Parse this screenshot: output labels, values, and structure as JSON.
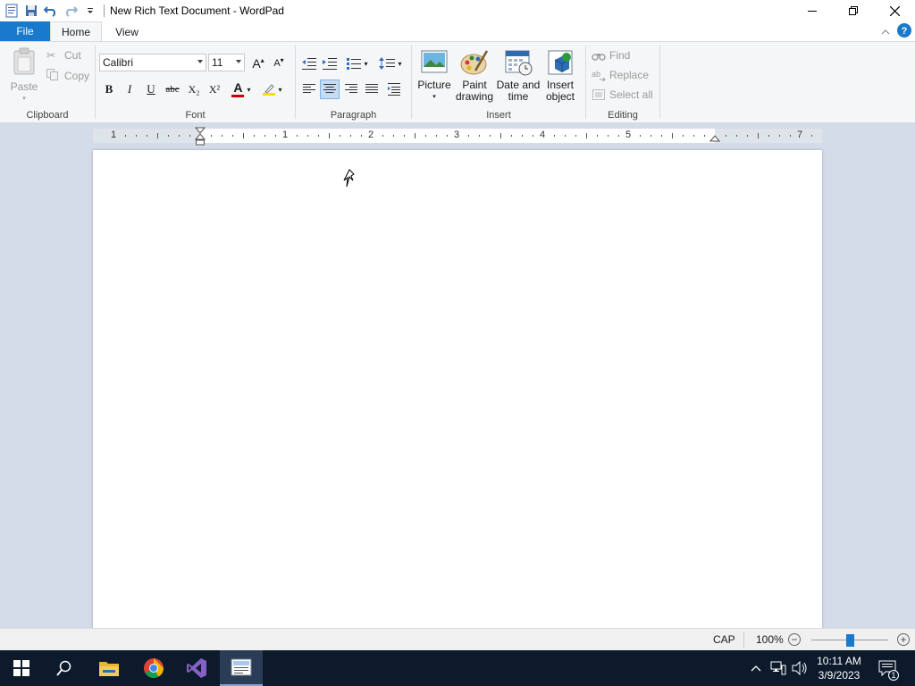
{
  "window": {
    "title": "New Rich Text Document - WordPad",
    "icons": [
      "wordpad-app-icon",
      "save-icon",
      "undo-icon",
      "redo-icon",
      "customize-qat-icon"
    ],
    "controls": [
      "minimize-icon",
      "maximize-icon",
      "close-icon"
    ]
  },
  "tabs": {
    "file": "File",
    "home": "Home",
    "view": "View"
  },
  "ribbon": {
    "clipboard": {
      "label": "Clipboard",
      "paste": "Paste",
      "cut": "Cut",
      "copy": "Copy"
    },
    "font": {
      "label": "Font",
      "family": "Calibri",
      "size": "11",
      "bold": "B",
      "italic": "I",
      "underline": "U",
      "strike": "abc",
      "subscript": "X₂",
      "superscript": "X²",
      "grow": "A",
      "shrink": "A",
      "color_letter": "A",
      "text_color": "#cc0000",
      "highlight_color": "#f2e200"
    },
    "paragraph": {
      "label": "Paragraph",
      "alignment": "center"
    },
    "insert": {
      "label": "Insert",
      "picture": "Picture",
      "paint_line1": "Paint",
      "paint_line2": "drawing",
      "date_line1": "Date and",
      "date_line2": "time",
      "object_line1": "Insert",
      "object_line2": "object"
    },
    "editing": {
      "label": "Editing",
      "find": "Find",
      "replace": "Replace",
      "select_all": "Select all"
    }
  },
  "ruler": {
    "numbers": [
      "1",
      "1",
      "2",
      "3",
      "4",
      "5",
      "7"
    ]
  },
  "statusbar": {
    "caps": "CAP",
    "zoom": "100%",
    "zoom_out": "−",
    "zoom_in": "+",
    "zoom_level_percent": 100
  },
  "taskbar": {
    "apps": [
      "start-button",
      "search-icon",
      "file-explorer-icon",
      "chrome-icon",
      "visual-studio-icon",
      "wordpad-taskbar-icon"
    ],
    "time": "10:11 AM",
    "date": "3/9/2023",
    "notification_count": "1"
  },
  "colors": {
    "accent": "#1979ca",
    "workspace": "#d4dbe9",
    "taskbar": "#0c1a2c"
  }
}
